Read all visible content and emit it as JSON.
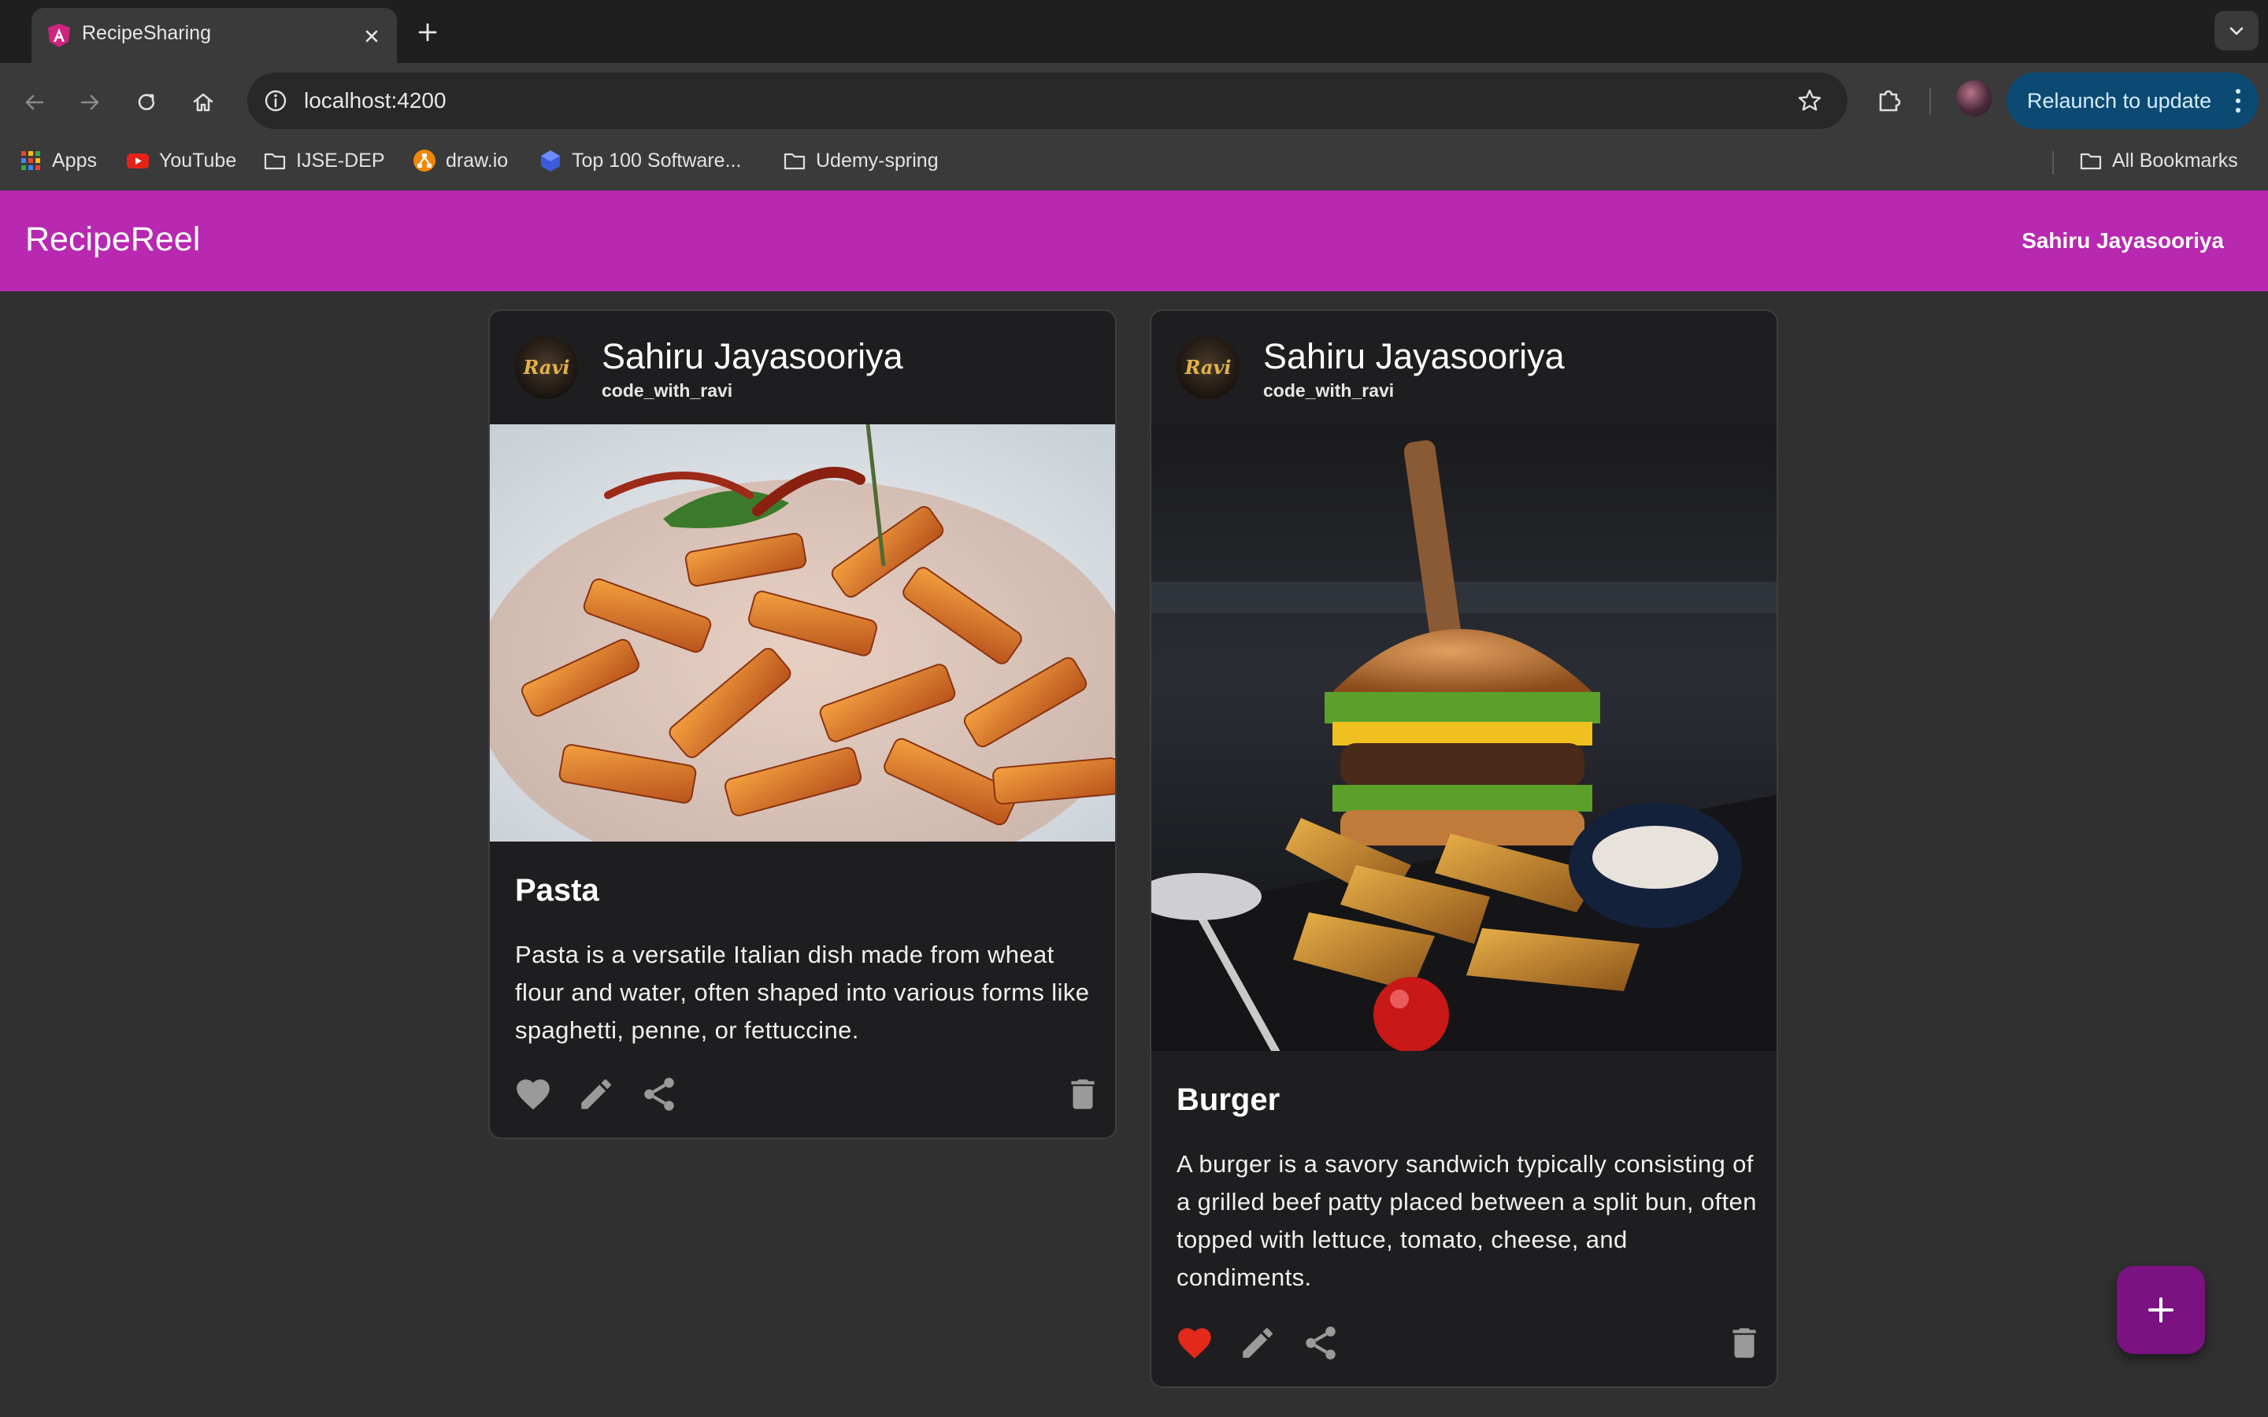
{
  "browser": {
    "tab_title": "RecipeSharing",
    "url": "localhost:4200",
    "relaunch_label": "Relaunch to update",
    "bookmarks": [
      "Apps",
      "YouTube",
      "IJSE-DEP",
      "draw.io",
      "Top 100 Software...",
      "Udemy-spring"
    ],
    "all_bookmarks": "All Bookmarks"
  },
  "app": {
    "title": "RecipeReel",
    "user": "Sahiru Jayasooriya",
    "accent": "#b828b0",
    "fab_color": "#7a1282"
  },
  "cards": [
    {
      "author": "Sahiru Jayasooriya",
      "handle": "code_with_ravi",
      "avatar_text": "Ravi",
      "title": "Pasta",
      "description": "Pasta is a versatile Italian dish made from wheat flour and water, often shaped into various forms like spaghetti, penne, or fettuccine.",
      "liked": false
    },
    {
      "author": "Sahiru Jayasooriya",
      "handle": "code_with_ravi",
      "avatar_text": "Ravi",
      "title": "Burger",
      "description": "A burger is a savory sandwich typically consisting of a grilled beef patty placed between a split bun, often topped with lettuce, tomato, cheese, and condiments.",
      "liked": true
    }
  ],
  "icons": {
    "like": "heart-icon",
    "edit": "pencil-icon",
    "share": "share-icon",
    "delete": "trash-icon",
    "add": "plus-icon"
  }
}
